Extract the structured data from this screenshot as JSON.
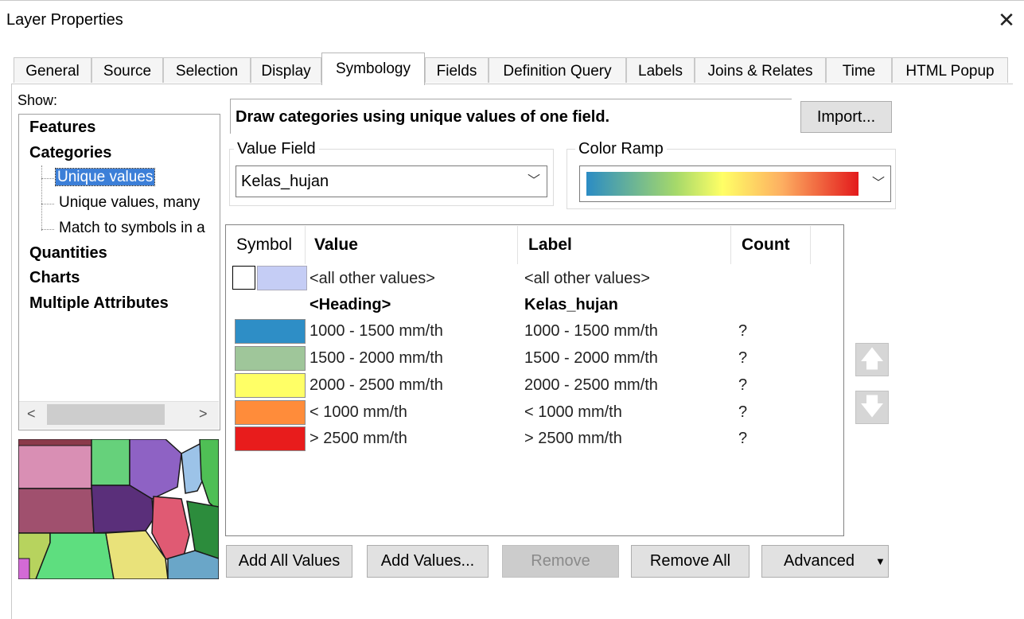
{
  "window": {
    "title": "Layer Properties",
    "close_icon": "close-icon"
  },
  "tabs": [
    {
      "label": "General"
    },
    {
      "label": "Source"
    },
    {
      "label": "Selection"
    },
    {
      "label": "Display"
    },
    {
      "label": "Symbology",
      "active": true
    },
    {
      "label": "Fields"
    },
    {
      "label": "Definition Query"
    },
    {
      "label": "Labels"
    },
    {
      "label": "Joins & Relates"
    },
    {
      "label": "Time"
    },
    {
      "label": "HTML Popup"
    }
  ],
  "show": {
    "label": "Show:",
    "items": [
      {
        "label": "Features"
      },
      {
        "label": "Categories"
      },
      {
        "label": "Unique values",
        "selected": true
      },
      {
        "label": "Unique values, many"
      },
      {
        "label": "Match to symbols in a"
      },
      {
        "label": "Quantities"
      },
      {
        "label": "Charts"
      },
      {
        "label": "Multiple Attributes"
      }
    ]
  },
  "symbology": {
    "description": "Draw categories using unique values of one field.",
    "import_label": "Import...",
    "value_field_title": "Value Field",
    "value_field": "Kelas_hujan",
    "color_ramp_title": "Color Ramp",
    "color_ramp_colors": [
      "#2b8cc4",
      "#a6d96a",
      "#ffff66",
      "#fdae61",
      "#e31a1c"
    ]
  },
  "table": {
    "headers": {
      "symbol": "Symbol",
      "value": "Value",
      "label": "Label",
      "count": "Count"
    },
    "rows": [
      {
        "value": "<all other values>",
        "label": "<all other values>",
        "count": "",
        "color": "#c5cdf5",
        "kind": "other"
      },
      {
        "value": "<Heading>",
        "label": "Kelas_hujan",
        "count": "",
        "color": "",
        "kind": "heading"
      },
      {
        "value": "1000 - 1500 mm/th",
        "label": "1000 - 1500 mm/th",
        "count": "?",
        "color": "#2e8ec6"
      },
      {
        "value": "1500 - 2000 mm/th",
        "label": "1500 - 2000 mm/th",
        "count": "?",
        "color": "#9fc69a"
      },
      {
        "value": "2000 - 2500 mm/th",
        "label": "2000 - 2500 mm/th",
        "count": "?",
        "color": "#ffff66"
      },
      {
        "value": "< 1000 mm/th",
        "label": "< 1000 mm/th",
        "count": "?",
        "color": "#ff8c3a"
      },
      {
        "value": "> 2500 mm/th",
        "label": "> 2500 mm/th",
        "count": "?",
        "color": "#e81c1c"
      }
    ]
  },
  "buttons": {
    "add_all": "Add All Values",
    "add_values": "Add Values...",
    "remove": "Remove",
    "remove_all": "Remove All",
    "advanced": "Advanced"
  }
}
